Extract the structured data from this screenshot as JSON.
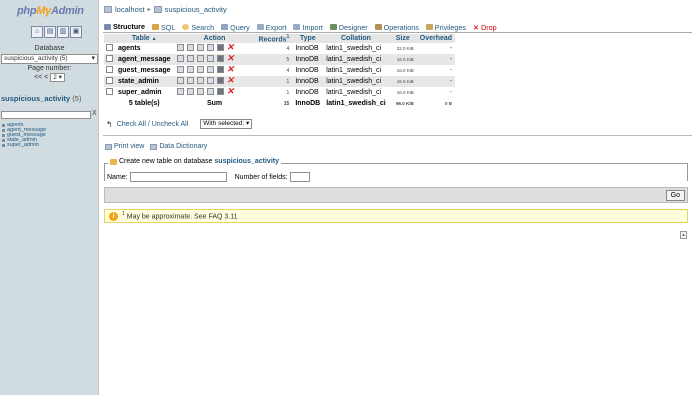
{
  "nav": {
    "logo_php": "php",
    "logo_my": "My",
    "logo_admin": "Admin",
    "icons": [
      "home-icon",
      "sql-query-icon",
      "docs-icon",
      "settings-icon"
    ],
    "database_label": "Database",
    "database_selected": "suspicious_activity (5)",
    "page_number_label": "Page number:",
    "page_prev": "<< <",
    "page_selected": "2",
    "current_db": "suspicious_activity",
    "current_db_count": "(5)",
    "filter_clear": "X",
    "tables": [
      "agents",
      "agent_message",
      "guest_message",
      "state_admin",
      "super_admin"
    ]
  },
  "breadcrumb": {
    "server": "localhost",
    "separator": "▸",
    "database": "suspicious_activity"
  },
  "tabs": [
    {
      "label": "Structure",
      "active": true,
      "icon": "structure-icon"
    },
    {
      "label": "SQL",
      "icon": "sql-icon"
    },
    {
      "label": "Search",
      "icon": "search-icon"
    },
    {
      "label": "Query",
      "icon": "query-icon"
    },
    {
      "label": "Export",
      "icon": "export-icon"
    },
    {
      "label": "Import",
      "icon": "import-icon"
    },
    {
      "label": "Designer",
      "icon": "designer-icon"
    },
    {
      "label": "Operations",
      "icon": "operations-icon"
    },
    {
      "label": "Privileges",
      "icon": "privileges-icon"
    },
    {
      "label": "Drop",
      "icon": "drop-icon"
    }
  ],
  "table": {
    "headers": {
      "table": "Table",
      "sort_indicator": "▲",
      "action": "Action",
      "records": "Records",
      "records_sup": "1",
      "type": "Type",
      "collation": "Collation",
      "size": "Size",
      "overhead": "Overhead"
    },
    "rows": [
      {
        "name": "agents",
        "records": "4",
        "type": "InnoDB",
        "collation": "latin1_swedish_ci",
        "size": "32.0 KiB",
        "overhead": "-"
      },
      {
        "name": "agent_message",
        "records": "5",
        "type": "InnoDB",
        "collation": "latin1_swedish_ci",
        "size": "16.0 KiB",
        "overhead": "-"
      },
      {
        "name": "guest_message",
        "records": "4",
        "type": "InnoDB",
        "collation": "latin1_swedish_ci",
        "size": "16.0 KiB",
        "overhead": "-"
      },
      {
        "name": "state_admin",
        "records": "1",
        "type": "InnoDB",
        "collation": "latin1_swedish_ci",
        "size": "16.0 KiB",
        "overhead": "-"
      },
      {
        "name": "super_admin",
        "records": "1",
        "type": "InnoDB",
        "collation": "latin1_swedish_ci",
        "size": "16.0 KiB",
        "overhead": "-"
      }
    ],
    "summary": {
      "tables": "5 table(s)",
      "action": "Sum",
      "records": "15",
      "type": "InnoDB",
      "collation": "latin1_swedish_ci",
      "size": "96.0 KiB",
      "overhead": "0 B"
    }
  },
  "bulk": {
    "check_all": "Check All / Uncheck All",
    "with_selected": "With selected:",
    "with_selected_arrow": "▾"
  },
  "links": {
    "print_view": "Print view",
    "data_dictionary": "Data Dictionary"
  },
  "create": {
    "legend_prefix": "Create new table on database",
    "legend_db": "suspicious_activity",
    "name_label": "Name:",
    "fields_label": "Number of fields:",
    "go": "Go"
  },
  "notice": {
    "sup": "1",
    "text": "May be approximate. See FAQ 3.11"
  }
}
